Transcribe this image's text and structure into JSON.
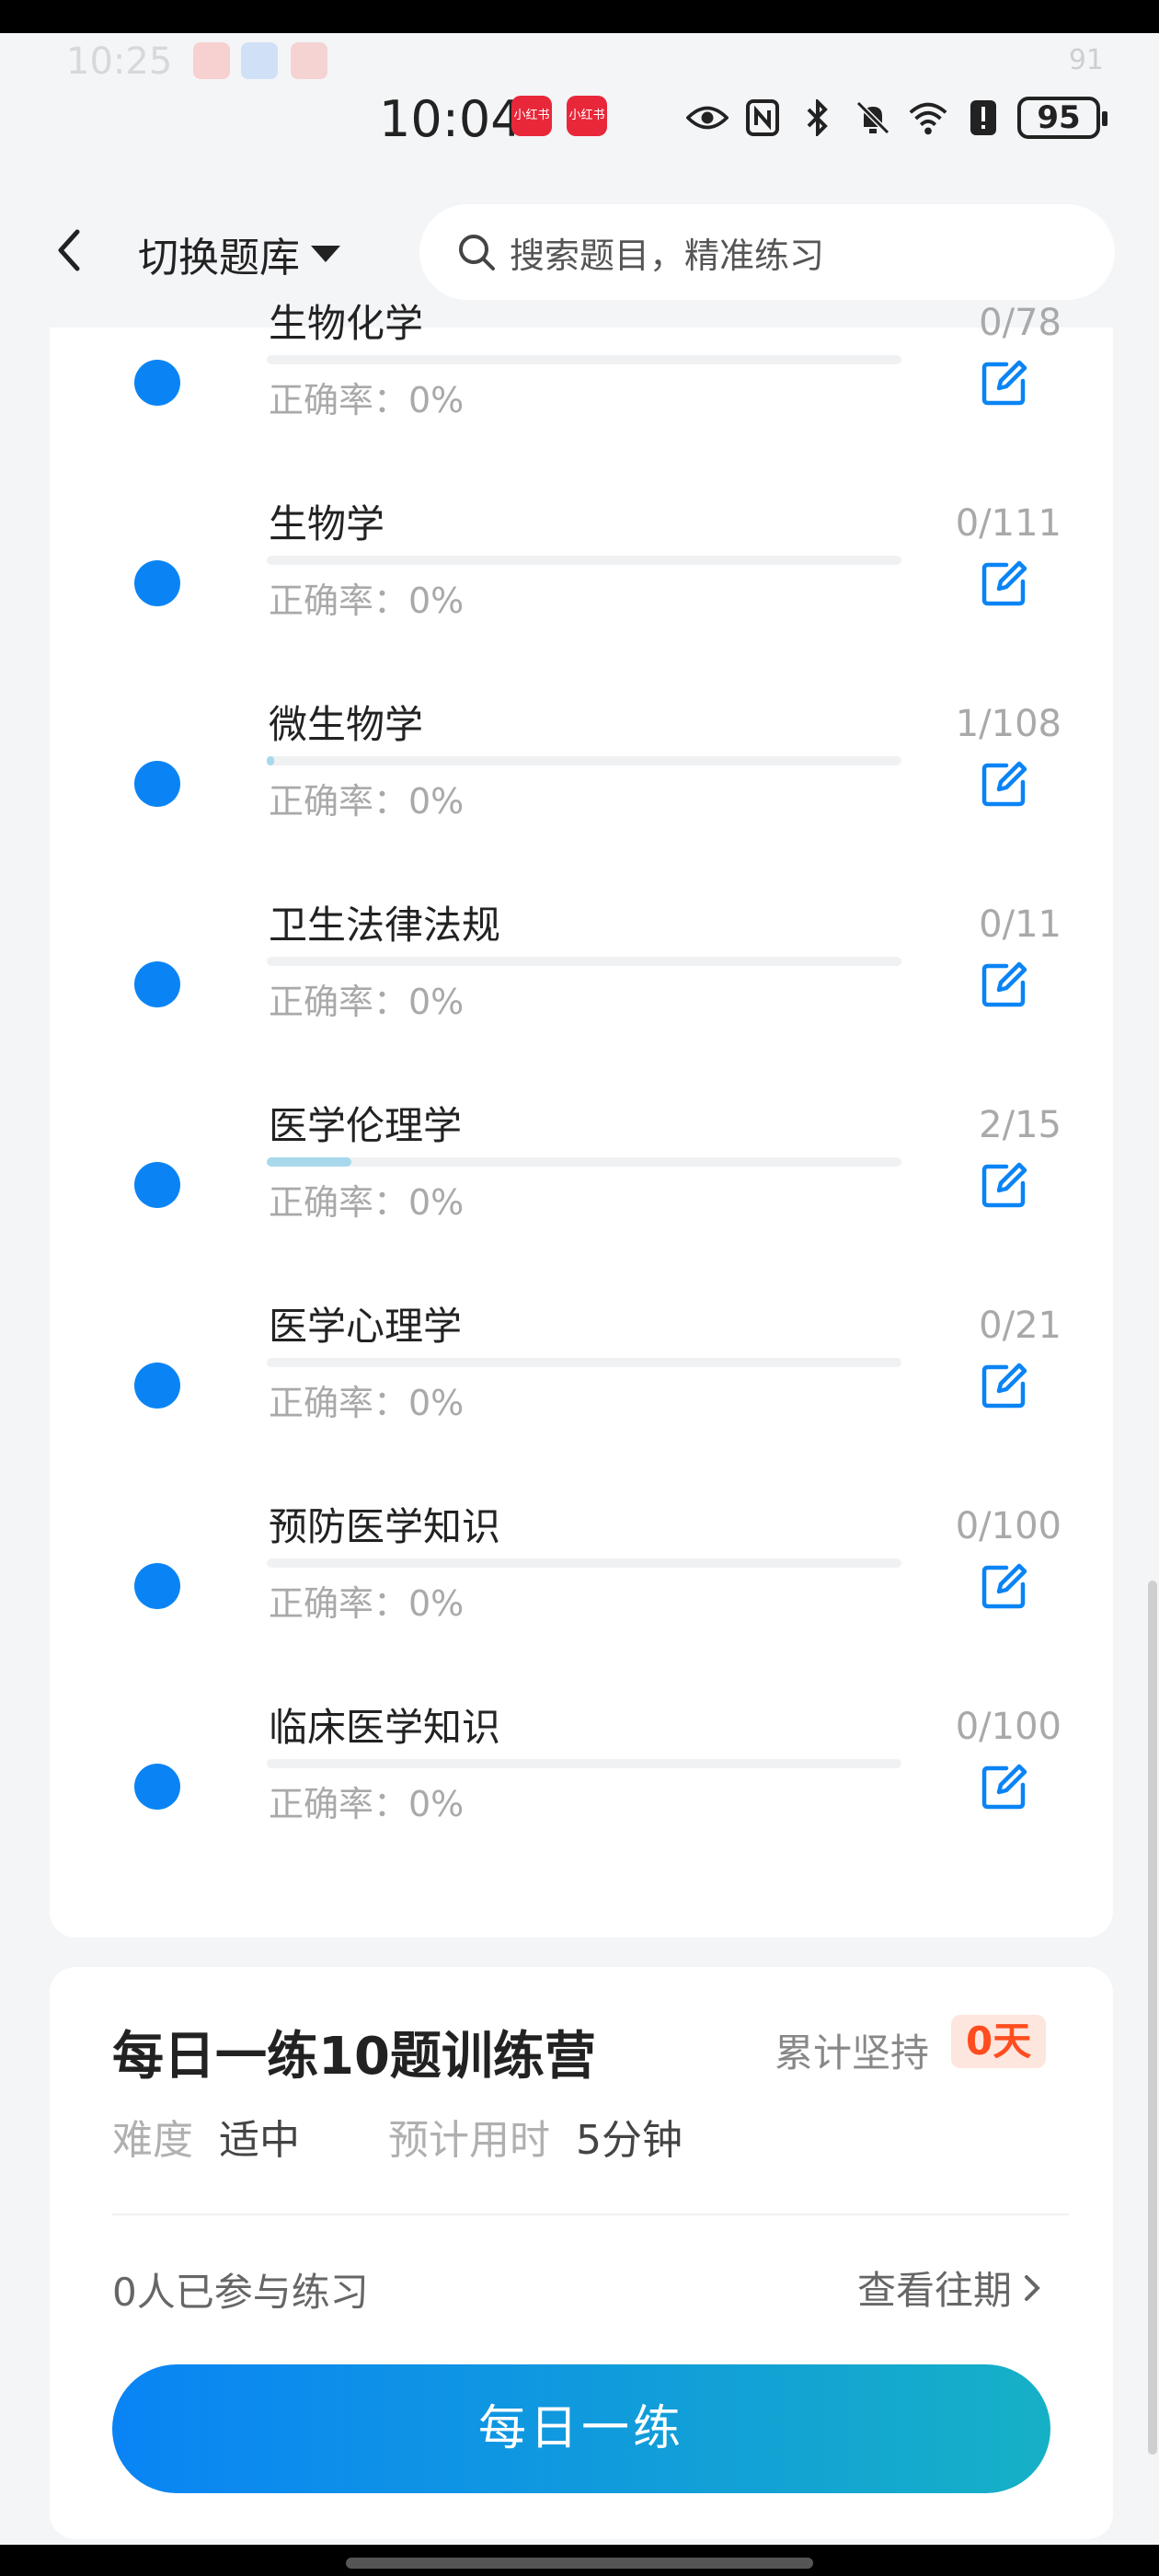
{
  "ghost_status": {
    "time": "10:25",
    "battery": "91"
  },
  "status_bar": {
    "time": "10:04",
    "app_badges": [
      "小红书",
      "小红书"
    ],
    "battery": "95",
    "icons": [
      "eye-icon",
      "nfc-icon",
      "bluetooth-icon",
      "mute-icon",
      "wifi-icon",
      "alert-icon"
    ]
  },
  "header": {
    "switch_label": "切换题库",
    "search_placeholder": "搜索题目，精准练习"
  },
  "list": {
    "accuracy_label": "正确率：0%",
    "items": [
      {
        "title": "生物化学",
        "count": "0/78",
        "progress": 0
      },
      {
        "title": "生物学",
        "count": "0/111",
        "progress": 0
      },
      {
        "title": "微生物学",
        "count": "1/108",
        "progress": 0.009
      },
      {
        "title": "卫生法律法规",
        "count": "0/11",
        "progress": 0
      },
      {
        "title": "医学伦理学",
        "count": "2/15",
        "progress": 0.133
      },
      {
        "title": "医学心理学",
        "count": "0/21",
        "progress": 0
      },
      {
        "title": "预防医学知识",
        "count": "0/100",
        "progress": 0
      },
      {
        "title": "临床医学知识",
        "count": "0/100",
        "progress": 0
      }
    ]
  },
  "daily": {
    "title": "每日一练10题训练营",
    "persist_label": "累计坚持",
    "persist_value": "0天",
    "difficulty_label": "难度",
    "difficulty_value": "适中",
    "time_label": "预计用时",
    "time_value": "5分钟",
    "participants": "0人已参与练习",
    "past_link": "查看往期",
    "cta": "每日一练"
  },
  "colors": {
    "accent": "#0a84f5",
    "cta_end": "#16b0c6",
    "badge_text": "#ff4d1f"
  }
}
